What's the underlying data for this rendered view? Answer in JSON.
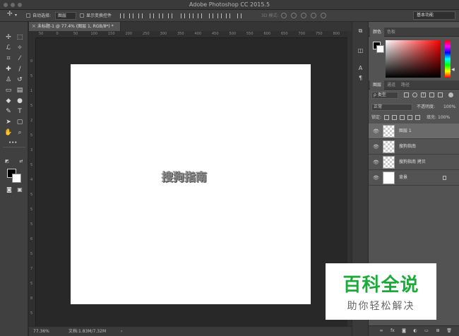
{
  "window": {
    "title": "Adobe Photoshop CC 2015.5"
  },
  "options_bar": {
    "auto_select_label": "自动选择:",
    "auto_select_value": "图层",
    "show_transform_label": "显示变换控件",
    "mode_3d_label": "3D 模式:",
    "workspace": "基本功能"
  },
  "document": {
    "tab_label": "未标题-1 @ 77.4% (图层 1, RGB/8*) *",
    "canvas_text": "搜狗指南",
    "zoom": "77.36%",
    "doc_info": "文档:1.83M/7.32M"
  },
  "ruler": {
    "h_ticks": [
      "50",
      "0",
      "50",
      "100",
      "150",
      "200",
      "250",
      "300",
      "350",
      "400",
      "450",
      "500",
      "550",
      "600",
      "650",
      "700",
      "750",
      "800"
    ],
    "v_ticks": [
      "0",
      "5",
      "1",
      "5",
      "2",
      "5",
      "3",
      "5",
      "4",
      "5",
      "5",
      "5",
      "6",
      "5",
      "7",
      "5",
      "8",
      "5"
    ]
  },
  "color_panel": {
    "tabs": [
      "颜色",
      "色板"
    ],
    "foreground": "#000000",
    "background": "#ffffff"
  },
  "layers_panel": {
    "tabs": [
      "图层",
      "通道",
      "路径"
    ],
    "filter_label": "ρ 类型",
    "blend_mode": "正常",
    "opacity_label": "不透明度:",
    "opacity_value": "100%",
    "lock_label": "锁定:",
    "fill_label": "填充:",
    "fill_value": "100%",
    "layers": [
      {
        "name": "图层 1",
        "selected": true,
        "thumb": "transparent"
      },
      {
        "name": "搜狗指南",
        "selected": false,
        "thumb": "transparent"
      },
      {
        "name": "搜狗指南 拷贝",
        "selected": false,
        "thumb": "transparent"
      },
      {
        "name": "背景",
        "selected": false,
        "thumb": "white",
        "locked": true
      }
    ]
  },
  "watermark": {
    "title": "百科全说",
    "subtitle": "助你轻松解决",
    "title_color": "#1eaa3a"
  }
}
